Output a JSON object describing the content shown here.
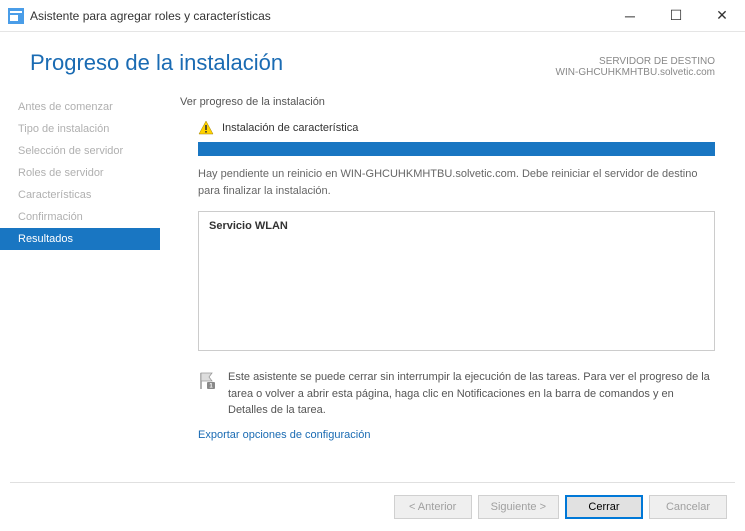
{
  "window": {
    "title": "Asistente para agregar roles y características"
  },
  "header": {
    "title": "Progreso de la instalación",
    "dest_label": "SERVIDOR DE DESTINO",
    "dest_value": "WIN-GHCUHKMHTBU.solvetic.com"
  },
  "sidebar": {
    "items": [
      {
        "label": "Antes de comenzar"
      },
      {
        "label": "Tipo de instalación"
      },
      {
        "label": "Selección de servidor"
      },
      {
        "label": "Roles de servidor"
      },
      {
        "label": "Características"
      },
      {
        "label": "Confirmación"
      },
      {
        "label": "Resultados"
      }
    ]
  },
  "content": {
    "section_label": "Ver progreso de la instalación",
    "feature_label": "Instalación de característica",
    "status_text": "Hay pendiente un reinicio en WIN-GHCUHKMHTBU.solvetic.com. Debe reiniciar el servidor de destino para finalizar la instalación.",
    "result_item": "Servicio WLAN",
    "info_text": "Este asistente se puede cerrar sin interrumpir la ejecución de las tareas. Para ver el progreso de la tarea o volver a abrir esta página, haga clic en Notificaciones en la barra de comandos y en Detalles de la tarea.",
    "export_link": "Exportar opciones de configuración"
  },
  "footer": {
    "prev": "< Anterior",
    "next": "Siguiente >",
    "close": "Cerrar",
    "cancel": "Cancelar"
  }
}
